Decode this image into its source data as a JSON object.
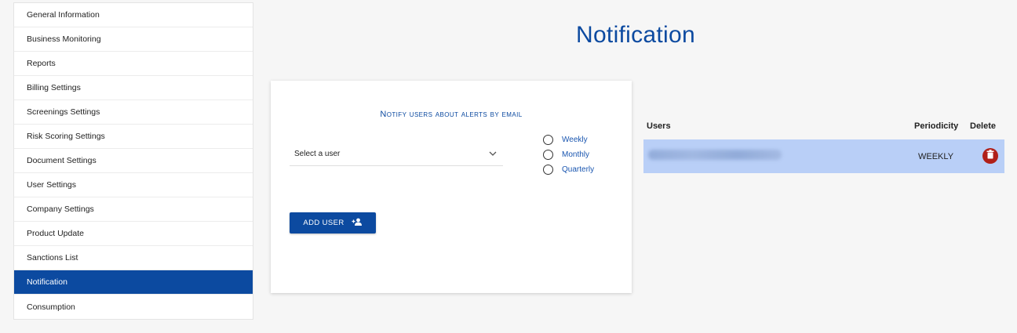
{
  "sidebar": {
    "items": [
      {
        "label": "General Information"
      },
      {
        "label": "Business Monitoring"
      },
      {
        "label": "Reports"
      },
      {
        "label": "Billing Settings"
      },
      {
        "label": "Screenings Settings"
      },
      {
        "label": "Risk Scoring Settings"
      },
      {
        "label": "Document Settings"
      },
      {
        "label": "User Settings"
      },
      {
        "label": "Company Settings"
      },
      {
        "label": "Product Update"
      },
      {
        "label": "Sanctions List"
      },
      {
        "label": "Notification"
      },
      {
        "label": "Consumption"
      }
    ],
    "active_label": "Notification"
  },
  "page": {
    "title": "Notification"
  },
  "notify_card": {
    "heading": "Notify users about alerts by email",
    "select": {
      "value": "Select a user",
      "icon": "chevron-down-icon"
    },
    "periodicity_options": [
      {
        "label": "Weekly"
      },
      {
        "label": "Monthly"
      },
      {
        "label": "Quarterly"
      }
    ],
    "add_button": {
      "label": "ADD USER",
      "icon": "person-add-icon"
    }
  },
  "users_table": {
    "headers": {
      "users": "Users",
      "periodicity": "Periodicity",
      "delete": "Delete"
    },
    "rows": [
      {
        "email": "",
        "periodicity": "WEEKLY",
        "delete_icon": "trash-icon"
      }
    ]
  },
  "colors": {
    "brand_blue": "#0c4aa0",
    "row_highlight": "#b9cff7",
    "delete_red": "#b02019",
    "page_background": "#f6f6f6"
  }
}
